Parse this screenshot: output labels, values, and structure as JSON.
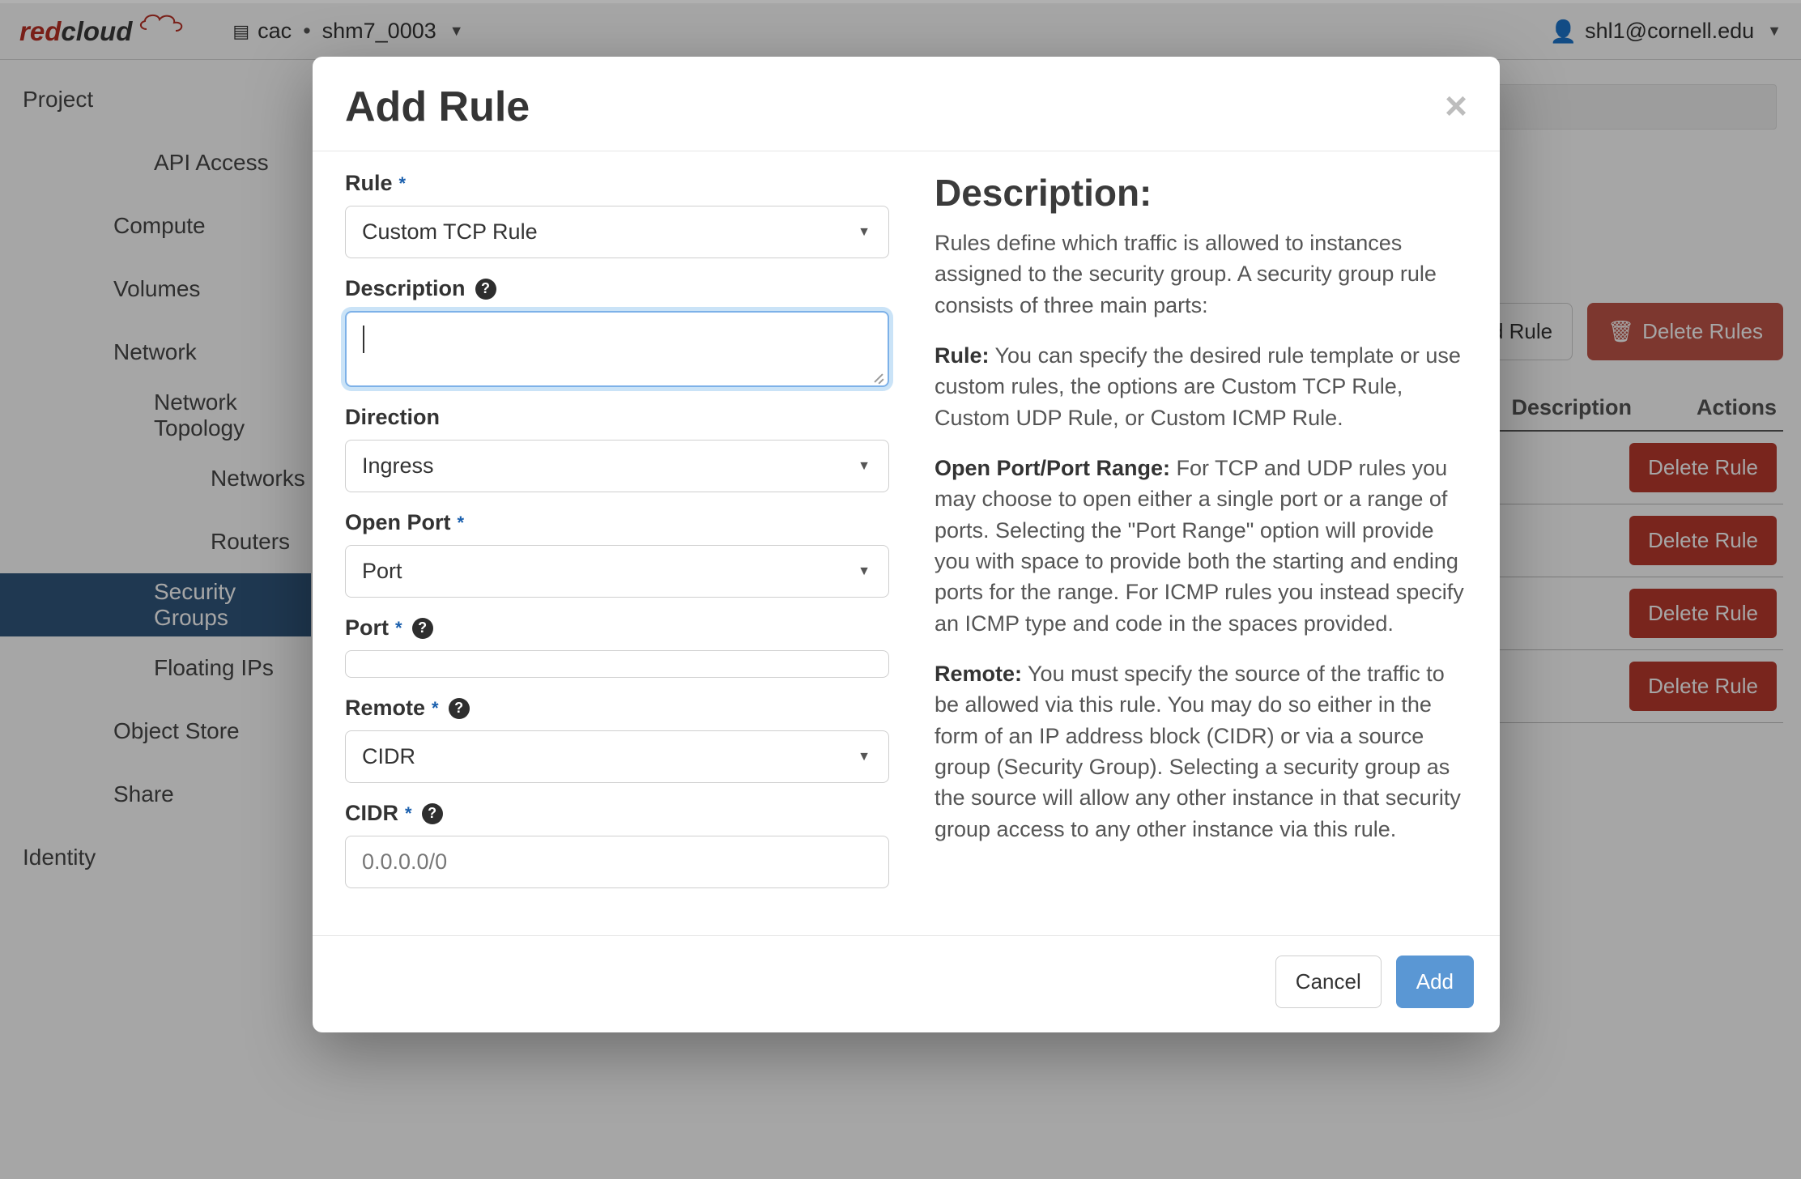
{
  "header": {
    "brand_left": "red",
    "brand_right": "cloud",
    "project_domain": "cac",
    "project_name": "shm7_0003",
    "user": "shl1@cornell.edu"
  },
  "sidebar": {
    "items": [
      {
        "label": "Project",
        "level": "level1",
        "interact": true
      },
      {
        "label": "API Access",
        "level": "level3",
        "interact": true
      },
      {
        "label": "Compute",
        "level": "level2",
        "interact": true
      },
      {
        "label": "Volumes",
        "level": "level2",
        "interact": true
      },
      {
        "label": "Network",
        "level": "level2",
        "interact": true
      },
      {
        "label": "Network Topology",
        "level": "level3",
        "interact": true
      },
      {
        "label": "Networks",
        "level": "level3b",
        "interact": true
      },
      {
        "label": "Routers",
        "level": "level3b",
        "interact": true
      },
      {
        "label": "Security Groups",
        "level": "level3",
        "interact": true,
        "active": true
      },
      {
        "label": "Floating IPs",
        "level": "level3",
        "interact": true
      },
      {
        "label": "Object Store",
        "level": "level2",
        "interact": true
      },
      {
        "label": "Share",
        "level": "level2",
        "interact": true
      },
      {
        "label": "Identity",
        "level": "level1",
        "interact": true
      }
    ]
  },
  "main": {
    "add_rule_btn": "Add Rule",
    "delete_rules_btn": "Delete Rules",
    "table": {
      "headers": {
        "description": "Description",
        "actions": "Actions"
      },
      "delete_label": "Delete Rule",
      "rows": 4
    }
  },
  "modal": {
    "title": "Add Rule",
    "form": {
      "rule": {
        "label": "Rule",
        "value": "Custom TCP Rule",
        "required": true
      },
      "description": {
        "label": "Description",
        "value": ""
      },
      "direction": {
        "label": "Direction",
        "value": "Ingress"
      },
      "open_port": {
        "label": "Open Port",
        "value": "Port",
        "required": true
      },
      "port": {
        "label": "Port",
        "value": "",
        "required": true
      },
      "remote": {
        "label": "Remote",
        "value": "CIDR",
        "required": true
      },
      "cidr": {
        "label": "CIDR",
        "value": "0.0.0.0/0",
        "required": true
      }
    },
    "help": {
      "heading": "Description:",
      "intro": "Rules define which traffic is allowed to instances assigned to the security group. A security group rule consists of three main parts:",
      "rule_label": "Rule:",
      "rule_text": " You can specify the desired rule template or use custom rules, the options are Custom TCP Rule, Custom UDP Rule, or Custom ICMP Rule.",
      "port_label": "Open Port/Port Range:",
      "port_text": " For TCP and UDP rules you may choose to open either a single port or a range of ports. Selecting the \"Port Range\" option will provide you with space to provide both the starting and ending ports for the range. For ICMP rules you instead specify an ICMP type and code in the spaces provided.",
      "remote_label": "Remote:",
      "remote_text": " You must specify the source of the traffic to be allowed via this rule. You may do so either in the form of an IP address block (CIDR) or via a source group (Security Group). Selecting a security group as the source will allow any other instance in that security group access to any other instance via this rule."
    },
    "footer": {
      "cancel": "Cancel",
      "add": "Add"
    }
  }
}
